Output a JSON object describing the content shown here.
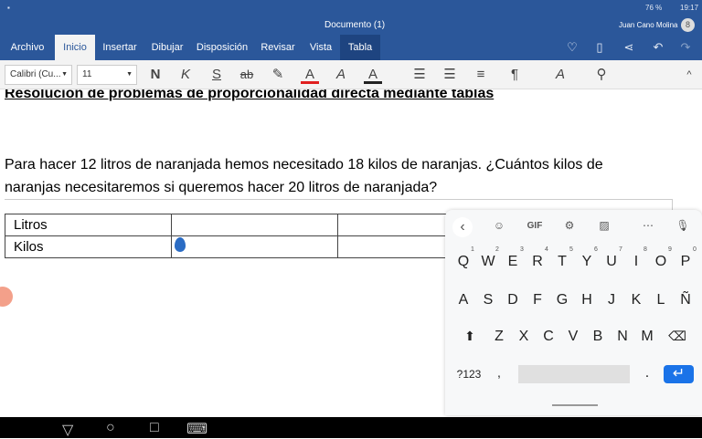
{
  "status": {
    "battery": "76 %",
    "time": "19:17"
  },
  "title": "Documento (1)",
  "user": {
    "name": "Juan Cano Molina",
    "initial": "8"
  },
  "tabs": [
    {
      "label": "Archivo"
    },
    {
      "label": "Inicio"
    },
    {
      "label": "Insertar"
    },
    {
      "label": "Dibujar"
    },
    {
      "label": "Disposición"
    },
    {
      "label": "Revisar"
    },
    {
      "label": "Vista"
    },
    {
      "label": "Tabla"
    }
  ],
  "toolbar": {
    "font": "Calibri (Cu...",
    "size": "11",
    "bold": "N",
    "italic": "K",
    "underline": "S",
    "strike": "ab",
    "font_color": "A",
    "clear": "A",
    "highlight_color": "A"
  },
  "document": {
    "heading": "Resolución de problemas de proporcionalidad directa mediante tablas",
    "line1": "Para hacer 12 litros de naranjada hemos necesitado 18 kilos de naranjas.  ¿Cuántos kilos de",
    "line2": "naranjas necesitaremos si queremos hacer 20 litros de naranjada?",
    "table": [
      [
        "Litros",
        "",
        "",
        ""
      ],
      [
        "Kilos",
        "",
        "",
        ""
      ]
    ]
  },
  "keyboard": {
    "gif": "GIF",
    "row1": [
      [
        "Q",
        "1"
      ],
      [
        "W",
        "2"
      ],
      [
        "E",
        "3"
      ],
      [
        "R",
        "4"
      ],
      [
        "T",
        "5"
      ],
      [
        "Y",
        "6"
      ],
      [
        "U",
        "7"
      ],
      [
        "I",
        "8"
      ],
      [
        "O",
        "9"
      ],
      [
        "P",
        "0"
      ]
    ],
    "row2": [
      "A",
      "S",
      "D",
      "F",
      "G",
      "H",
      "J",
      "K",
      "L",
      "Ñ"
    ],
    "row3": [
      "Z",
      "X",
      "C",
      "V",
      "B",
      "N",
      "M"
    ],
    "symbols": "?123",
    "comma": ",",
    "period": "."
  },
  "colors": {
    "brand": "#2b579a",
    "enter": "#1a73e8"
  }
}
